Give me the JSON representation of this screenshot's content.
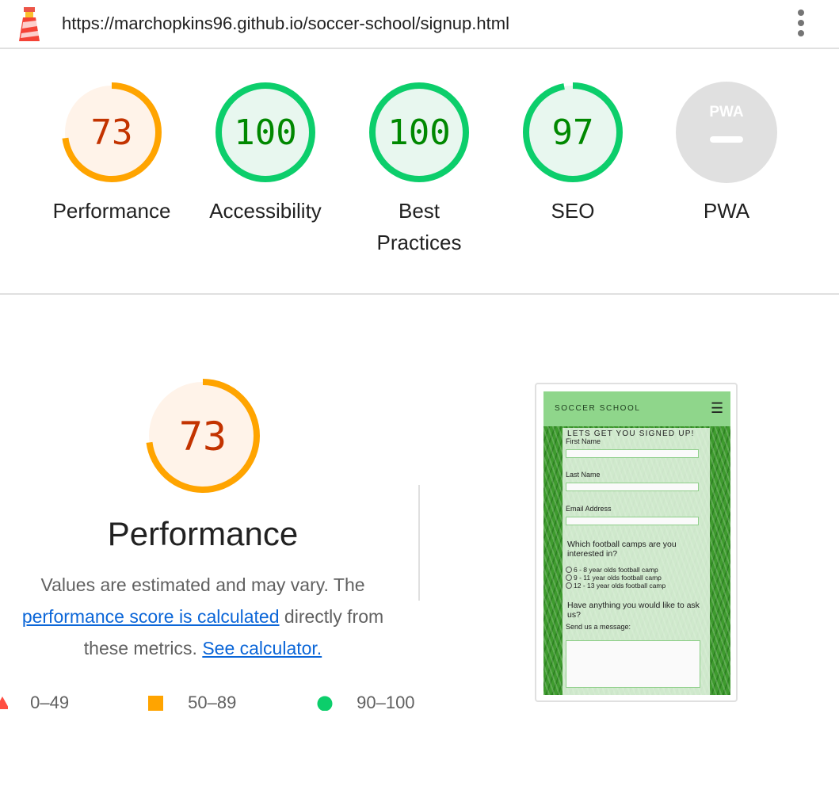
{
  "header": {
    "url": "https://marchopkins96.github.io/soccer-school/signup.html"
  },
  "colors": {
    "orange": "#ffa400",
    "orange_text": "#c33300",
    "orange_fill": "#fff3e9",
    "green": "#0cce6b",
    "green_text": "#008800",
    "green_fill": "#e8f7ef",
    "grey": "#e0e0e0"
  },
  "gauges": [
    {
      "score": "73",
      "label": "Performance",
      "fraction": 0.73,
      "rating": "average"
    },
    {
      "score": "100",
      "label": "Accessibility",
      "fraction": 1.0,
      "rating": "pass"
    },
    {
      "score": "100",
      "label": "Best",
      "label2": "Practices",
      "fraction": 1.0,
      "rating": "pass"
    },
    {
      "score": "97",
      "label": "SEO",
      "fraction": 0.97,
      "rating": "pass"
    },
    {
      "score": "",
      "label": "PWA",
      "badge": "PWA",
      "rating": "na"
    }
  ],
  "performance": {
    "score": "73",
    "fraction": 0.73,
    "title": "Performance",
    "desc_1": "Values are estimated and may vary. The",
    "link_score": "performance score is calculated",
    "desc_2": "directly from",
    "desc_3": "these metrics.",
    "link_calc": "See calculator."
  },
  "legend": [
    {
      "icon": "triangle-icon",
      "range": "0–49"
    },
    {
      "icon": "square-icon",
      "range": "50–89"
    },
    {
      "icon": "circle-icon",
      "range": "90–100"
    }
  ],
  "screenshot": {
    "brand": "SOCCER SCHOOL",
    "heading": "LETS GET YOU SIGNED UP!",
    "first_name": "First Name",
    "last_name": "Last Name",
    "email": "Email Address",
    "question_camps": "Which football camps are you interested in?",
    "options": [
      "6 - 8 year olds football camp",
      "9 - 11 year olds football camp",
      "12 - 13 year olds football camp"
    ],
    "question_ask": "Have anything you would like to ask us?",
    "message_label": "Send us a message:"
  }
}
